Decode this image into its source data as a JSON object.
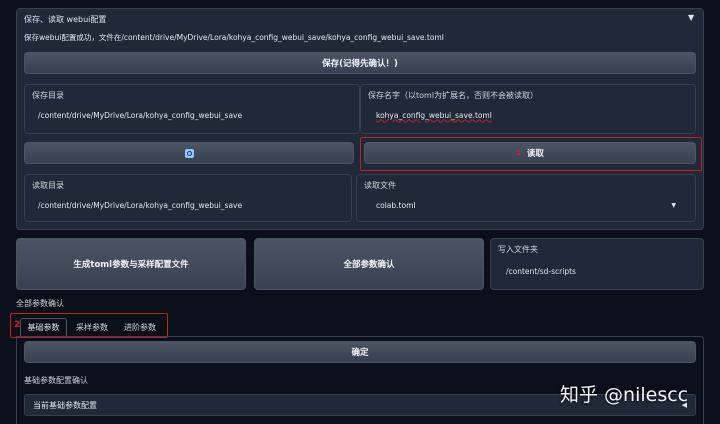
{
  "accordion": {
    "title": "保存、读取 webui配置",
    "toggle_icon": "▼",
    "status": "保存webui配置成功，文件在/content/drive/MyDrive/Lora/kohya_config_webui_save/kohya_config_webui_save.toml"
  },
  "save": {
    "button_label": "保存(记得先确认！)",
    "dir_label": "保存目录",
    "dir_value": "/content/drive/MyDrive/Lora/kohya_config_webui_save",
    "name_label": "保存名字（以toml为扩展名，否则不会被读取）",
    "name_value": "kohya_config_webui_save.toml"
  },
  "load": {
    "refresh_icon": "refresh-icon",
    "step_number": "1",
    "button_label": "读取",
    "dir_label": "读取目录",
    "dir_value": "/content/drive/MyDrive/Lora/kohya_config_webui_save",
    "file_label": "读取文件",
    "file_value": "colab.toml"
  },
  "actions": {
    "generate_label": "生成toml参数与采样配置文件",
    "confirm_all_label": "全部参数确认",
    "write_dir_label": "写入文件夹",
    "write_dir_value": "/content/sd-scripts"
  },
  "confirm_section": {
    "title": "全部参数确认",
    "step_number": "2",
    "tabs": [
      {
        "label": "基础参数",
        "active": true
      },
      {
        "label": "采样参数",
        "active": false
      },
      {
        "label": "进阶参数",
        "active": false
      }
    ],
    "ok_label": "确定",
    "basic_confirm_label": "基础参数配置确认",
    "current_basic_label": "当前基础参数配置"
  },
  "watermark": "知乎 @nilescc",
  "colors": {
    "background": "#0b0f19",
    "panel": "#1f2937",
    "highlight_red": "#c81e1e"
  }
}
